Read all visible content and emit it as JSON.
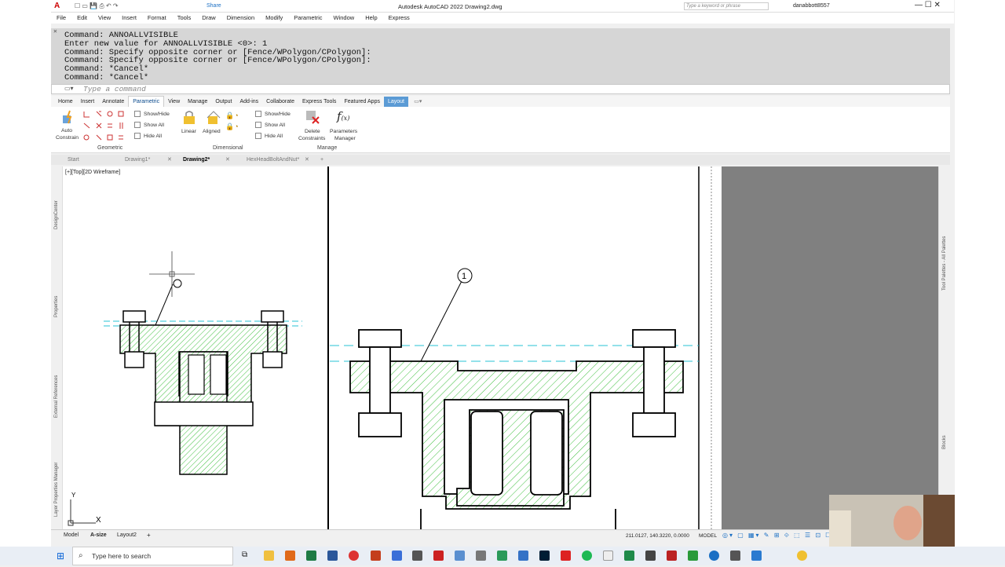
{
  "window": {
    "title": "Autodesk AutoCAD 2022   Drawing2.dwg",
    "search_placeholder": "Type a keyword or phrase",
    "user": "danabbott8557",
    "share_label": "Share"
  },
  "menu": [
    "File",
    "Edit",
    "View",
    "Insert",
    "Format",
    "Tools",
    "Draw",
    "Dimension",
    "Modify",
    "Parametric",
    "Window",
    "Help",
    "Express"
  ],
  "command_history": [
    "Command: ANNOALLVISIBLE",
    "Enter new value for ANNOALLVISIBLE <0>: 1",
    "Command: Specify opposite corner or [Fence/WPolygon/CPolygon]:",
    "Command: Specify opposite corner or [Fence/WPolygon/CPolygon]:",
    "Command: *Cancel*",
    "Command: *Cancel*"
  ],
  "command_placeholder": "Type a command",
  "ribbon_tabs": [
    "Home",
    "Insert",
    "Annotate",
    "Parametric",
    "View",
    "Manage",
    "Output",
    "Add-ins",
    "Collaborate",
    "Express Tools",
    "Featured Apps",
    "Layout"
  ],
  "ribbon": {
    "geometric": {
      "auto_constrain": "Auto\nConstrain",
      "auto_label_1": "Auto",
      "auto_label_2": "Constrain",
      "show_hide": "Show/Hide",
      "show_all": "Show All",
      "hide_all": "Hide All",
      "panel": "Geometric"
    },
    "dimensional": {
      "linear": "Linear",
      "aligned": "Aligned",
      "show_hide": "Show/Hide",
      "show_all": "Show All",
      "hide_all": "Hide All",
      "panel": "Dimensional"
    },
    "manage": {
      "delete_1": "Delete",
      "delete_2": "Constraints",
      "params_1": "Parameters",
      "params_2": "Manager",
      "panel": "Manage"
    }
  },
  "doc_tabs": [
    "Start",
    "Drawing1*",
    "Drawing2*",
    "HexHeadBoltAndNut*"
  ],
  "viewport_label": "[+][Top][2D Wireframe]",
  "left_palettes": [
    "DesignCenter",
    "Properties",
    "External References",
    "Layer Properties Manager"
  ],
  "right_palettes": [
    "Tool Palettes - All Palettes",
    "Blocks"
  ],
  "balloon_number": "1",
  "ucs": {
    "x": "X",
    "y": "Y"
  },
  "layout_tabs": [
    "Model",
    "A-size",
    "Layout2"
  ],
  "status": {
    "coords": "211.0127, 140.3220, 0.0000",
    "mode": "MODEL"
  },
  "taskbar": {
    "search": "Type here to search"
  },
  "colors": {
    "hatch": "#3fbf3f",
    "cyan": "#27c3d6",
    "accent": "#5b9bd5"
  }
}
